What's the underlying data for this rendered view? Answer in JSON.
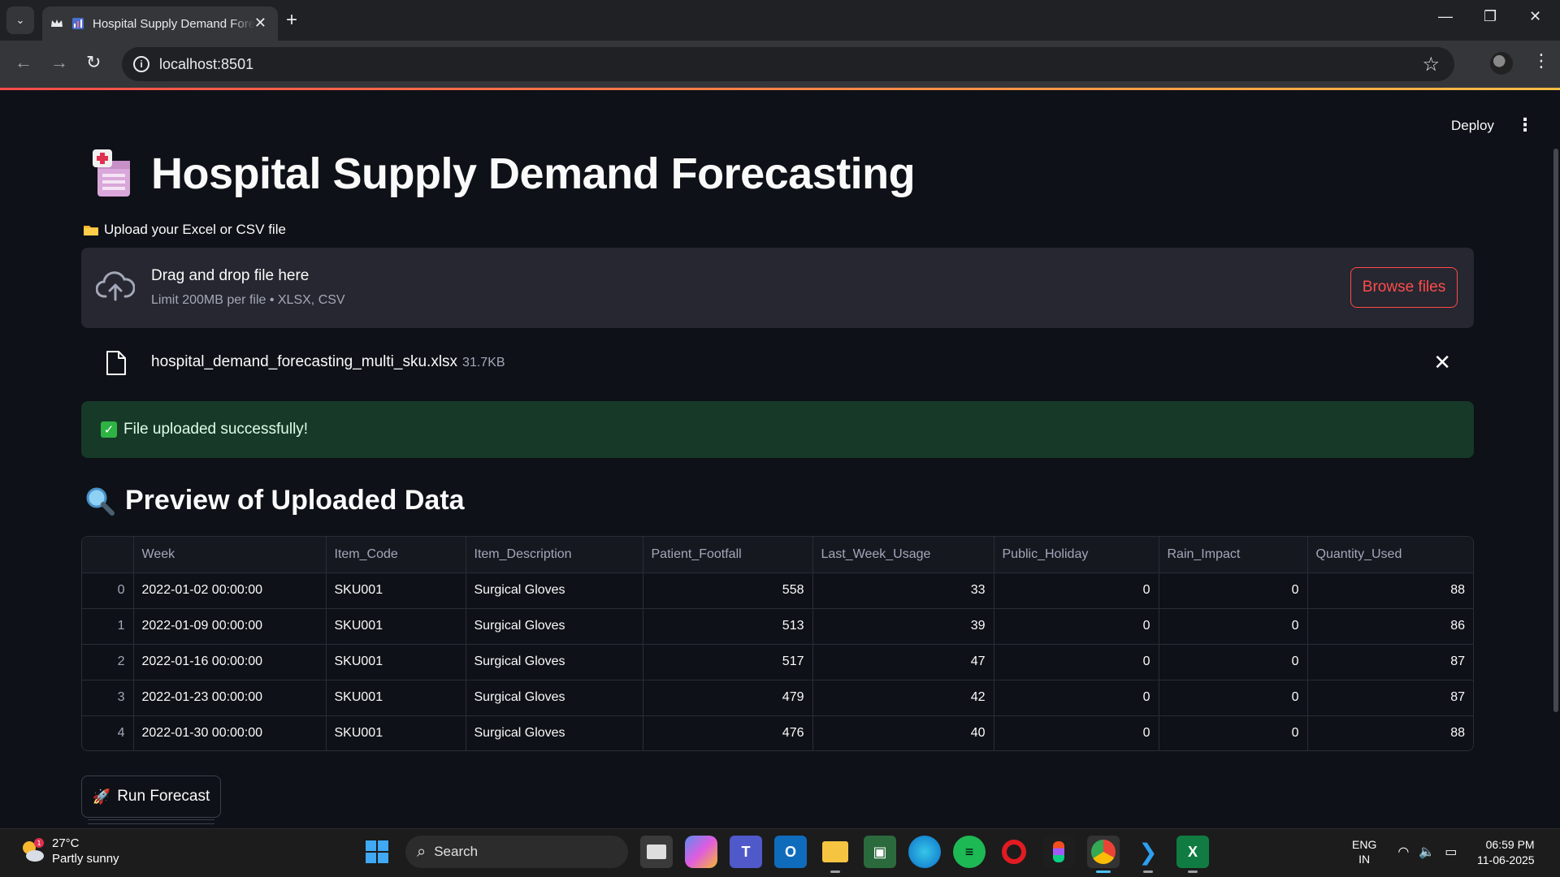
{
  "browser": {
    "tab_title": "Hospital Supply Demand Forecasting",
    "url": "localhost:8501"
  },
  "app": {
    "deploy_label": "Deploy",
    "title": "Hospital Supply Demand Forecasting",
    "upload_label": "Upload your Excel or CSV file",
    "dropzone": {
      "title": "Drag and drop file here",
      "subtitle": "Limit 200MB per file • XLSX, CSV",
      "browse_label": "Browse files"
    },
    "file": {
      "name": "hospital_demand_forecasting_multi_sku.xlsx",
      "size": "31.7KB"
    },
    "success_message": "File uploaded successfully!",
    "preview_title": "Preview of Uploaded Data",
    "table": {
      "columns": [
        "",
        "Week",
        "Item_Code",
        "Item_Description",
        "Patient_Footfall",
        "Last_Week_Usage",
        "Public_Holiday",
        "Rain_Impact",
        "Quantity_Used"
      ],
      "rows": [
        [
          "0",
          "2022-01-02 00:00:00",
          "SKU001",
          "Surgical Gloves",
          "558",
          "33",
          "0",
          "0",
          "88"
        ],
        [
          "1",
          "2022-01-09 00:00:00",
          "SKU001",
          "Surgical Gloves",
          "513",
          "39",
          "0",
          "0",
          "86"
        ],
        [
          "2",
          "2022-01-16 00:00:00",
          "SKU001",
          "Surgical Gloves",
          "517",
          "47",
          "0",
          "0",
          "87"
        ],
        [
          "3",
          "2022-01-23 00:00:00",
          "SKU001",
          "Surgical Gloves",
          "479",
          "42",
          "0",
          "0",
          "87"
        ],
        [
          "4",
          "2022-01-30 00:00:00",
          "SKU001",
          "Surgical Gloves",
          "476",
          "40",
          "0",
          "0",
          "88"
        ]
      ]
    },
    "run_button_label": "Run Forecast"
  },
  "taskbar": {
    "weather_temp": "27°C",
    "weather_desc": "Partly sunny",
    "weather_badge": "1",
    "search_label": "Search",
    "lang_top": "ENG",
    "lang_bottom": "IN",
    "time": "06:59 PM",
    "date": "11-06-2025"
  },
  "colors": {
    "accent": "#ff4b4b",
    "background": "#0e1117",
    "success_bg": "#173928"
  }
}
